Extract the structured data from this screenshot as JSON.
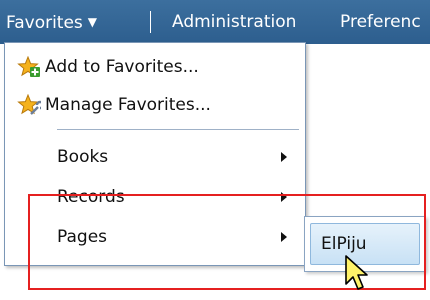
{
  "menubar": {
    "favorites_label": "Favorites",
    "administration_label": "Administration",
    "preferences_label": "Preferenc"
  },
  "favorites_menu": {
    "add_to_favorites": "Add to Favorites...",
    "manage_favorites": "Manage Favorites...",
    "items": [
      {
        "label": "Books"
      },
      {
        "label": "Records"
      },
      {
        "label": "Pages"
      }
    ]
  },
  "pages_submenu": {
    "items": [
      {
        "label": "ElPiju"
      }
    ]
  },
  "icons": {
    "add_to_favorites": "star-plus-icon",
    "manage_favorites": "star-wrench-icon",
    "menubar_dropdown": "chevron-down-icon",
    "submenu_arrow": "triangle-right-icon",
    "cursor": "arrow-cursor-icon"
  },
  "colors": {
    "menubar": "#2d5e8e",
    "submenu_highlight": "#c8e1f5",
    "annotation_box": "#e52020"
  }
}
